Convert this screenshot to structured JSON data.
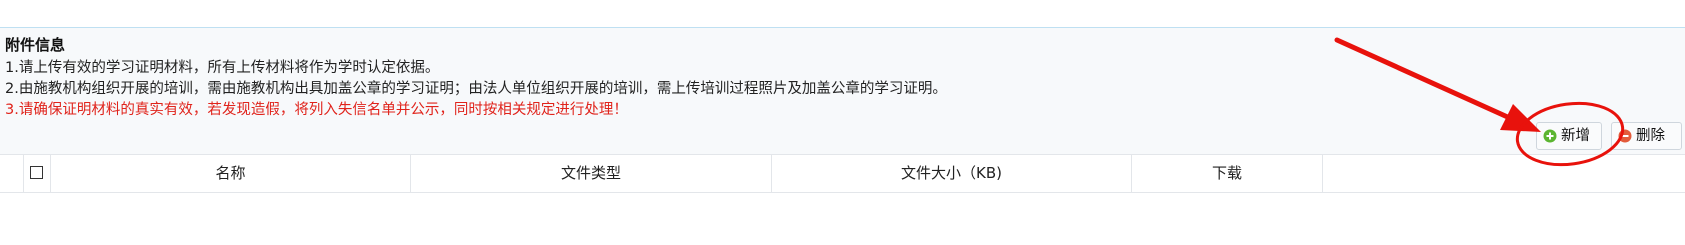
{
  "section": {
    "title": "附件信息",
    "notes": [
      "1.请上传有效的学习证明材料，所有上传材料将作为学时认定依据。",
      "2.由施教机构组织开展的培训，需由施教机构出具加盖公章的学习证明；由法人单位组织开展的培训，需上传培训过程照片及加盖公章的学习证明。",
      "3.请确保证明材料的真实有效，若发现造假，将列入失信名单并公示，同时按相关规定进行处理！"
    ]
  },
  "toolbar": {
    "add_label": "新增",
    "add_icon": "plus-circle-icon",
    "add_icon_color": "#5cb531",
    "delete_label": "删除",
    "delete_icon": "minus-circle-icon",
    "delete_icon_color": "#e35b3b"
  },
  "table": {
    "columns": [
      "名称",
      "文件类型",
      "文件大小（KB)",
      "下载"
    ],
    "rows": []
  },
  "annotation": {
    "color": "#e8120c",
    "arrow_icon": "red-arrow-annotation",
    "circle_icon": "red-circle-annotation"
  }
}
